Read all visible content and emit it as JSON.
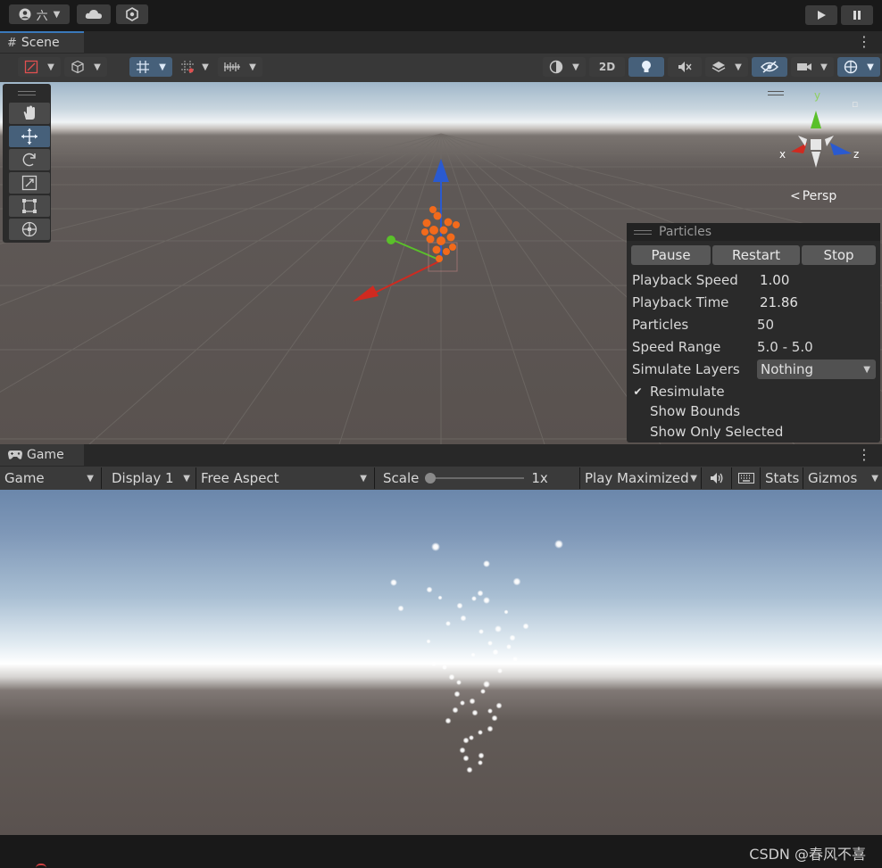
{
  "top_toolbar": {
    "account_label": "六",
    "play_icon": "play-icon",
    "pause_icon": "pause-icon"
  },
  "scene": {
    "tab_label": "Scene",
    "toolbar": {
      "mode_2d": "2D"
    },
    "gizmo": {
      "x": "x",
      "y": "y",
      "z": "z",
      "persp_label": "Persp"
    },
    "tools": [
      "hand-tool",
      "move-tool",
      "rotate-tool",
      "scale-tool",
      "rect-tool",
      "transform-tool"
    ],
    "particles_panel": {
      "title": "Particles",
      "pause": "Pause",
      "restart": "Restart",
      "stop": "Stop",
      "rows": [
        {
          "label": "Playback Speed",
          "value": "1.00"
        },
        {
          "label": "Playback Time",
          "value": "21.86"
        },
        {
          "label": "Particles",
          "value": "50"
        },
        {
          "label": "Speed Range",
          "value": "5.0 - 5.0"
        },
        {
          "label": "Simulate Layers",
          "value": "Nothing"
        }
      ],
      "checks": [
        {
          "label": "Resimulate",
          "checked": true
        },
        {
          "label": "Show Bounds",
          "checked": false
        },
        {
          "label": "Show Only Selected",
          "checked": false
        }
      ]
    }
  },
  "game": {
    "tab_label": "Game",
    "toolbar": {
      "view": "Game",
      "display": "Display 1",
      "aspect": "Free Aspect",
      "scale_label": "Scale",
      "scale_value": "1x",
      "play_mode": "Play Maximized",
      "stats": "Stats",
      "gizmos": "Gizmos"
    }
  },
  "watermark": "CSDN @春风不喜",
  "colors": {
    "accent": "#3a79bb",
    "x_axis": "#d02a20",
    "y_axis": "#5ac02a",
    "z_axis": "#2a5ad0",
    "particle_orange": "#f26a1b"
  }
}
